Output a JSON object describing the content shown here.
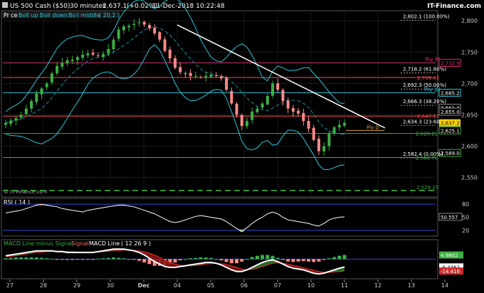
{
  "header": {
    "symbol": "US 500 Cash ($50)",
    "interval": "30 minutes",
    "last": "2,637.1",
    "change": "(+0.02%)",
    "datetime": "11-Dec-2018 10:22:48",
    "brand": "IT-Finance.com"
  },
  "indicator_legend": {
    "price": "Price",
    "boll_up": "Boll up",
    "boll_down": "Boll down",
    "boll_middle": "Boll middle",
    "boll_params": "( 20,2 )"
  },
  "watermark": "© IT-Finance.com",
  "colors": {
    "background": "#000000",
    "candle_up": "#3cb043",
    "candle_down": "#ff8a8a",
    "bollinger": "#2ec7d9",
    "bollinger_mid": "#1e8fa3",
    "trendline": "#ffffff",
    "pivot_line": "#d4306f",
    "fib_line": "#ff4d4d",
    "green_level": "#3cb043",
    "pivot_w": "#2ec7d9",
    "pivot_d": "#d9a441",
    "rsi_line": "#ffffff",
    "macd_line": "#ffffff",
    "signal_line": "#cc2b2b",
    "macd_hist_up": "#3cb043",
    "macd_hist_down": "#ff8a8a"
  },
  "chart_data": [
    {
      "type": "candlestick",
      "title": "US 500 Cash ($50) 30 minutes",
      "x_ticks": [
        "27",
        "28",
        "29",
        "30",
        "Dec",
        "04",
        "05",
        "06",
        "07",
        "10",
        "11",
        "12",
        "13",
        "14"
      ],
      "y_ticks": [
        "2,800",
        "2,750",
        "2,700",
        "2,650",
        "2,600",
        "2,550"
      ],
      "ylim": [
        2520,
        2815
      ],
      "close_series": [
        2637,
        2641,
        2645,
        2650,
        2660,
        2672,
        2684,
        2692,
        2700,
        2716,
        2728,
        2733,
        2737,
        2738,
        2742,
        2746,
        2748,
        2746,
        2744,
        2747,
        2755,
        2770,
        2786,
        2791,
        2792,
        2795,
        2798,
        2794,
        2788,
        2780,
        2770,
        2752,
        2740,
        2725,
        2718,
        2716,
        2712,
        2712,
        2710,
        2712,
        2714,
        2712,
        2708,
        2690,
        2668,
        2650,
        2632,
        2640,
        2655,
        2660,
        2668,
        2680,
        2700,
        2690,
        2672,
        2660,
        2655,
        2652,
        2640,
        2628,
        2610,
        2592,
        2600,
        2620,
        2630,
        2634,
        2637
      ],
      "levels": [
        {
          "label": "2,802.1 (100.00%)",
          "value": 2802.1,
          "kind": "fib"
        },
        {
          "label": "Piv M",
          "value": 2732.9,
          "kind": "pivot"
        },
        {
          "label": "2,732.9",
          "value": 2732.9,
          "kind": "pivot_box"
        },
        {
          "label": "2,718.2 (61.80%)",
          "value": 2718.2,
          "kind": "fib"
        },
        {
          "label": "2,709.45",
          "value": 2709.45,
          "kind": "red"
        },
        {
          "label": "2,692.3 (50.00%)",
          "value": 2692.3,
          "kind": "fib"
        },
        {
          "label": "Piv W",
          "value": 2685.2,
          "kind": "pivot_w"
        },
        {
          "label": "2,685.2",
          "value": 2685.2,
          "kind": "pivot_w_box"
        },
        {
          "label": "2,666.3 (38.20%)",
          "value": 2666.3,
          "kind": "fib"
        },
        {
          "label": "2,661.2",
          "value": 2661.2,
          "kind": "plain_box"
        },
        {
          "label": "2,647.95",
          "value": 2647.95,
          "kind": "red"
        },
        {
          "label": "2,655.0",
          "value": 2655.0,
          "kind": "plain_box"
        },
        {
          "label": "2,634.3 (23.60%)",
          "value": 2634.3,
          "kind": "fib"
        },
        {
          "label": "2,637.2",
          "value": 2637.2,
          "kind": "last_box"
        },
        {
          "label": "Piv D",
          "value": 2625.1,
          "kind": "pivot_d"
        },
        {
          "label": "2,625.1",
          "value": 2625.1,
          "kind": "green_box"
        },
        {
          "label": "2,620.22",
          "value": 2620.22,
          "kind": "green"
        },
        {
          "label": "2,589.0",
          "value": 2589.0,
          "kind": "green_box"
        },
        {
          "label": "2,582.4 (0.00%)",
          "value": 2582.4,
          "kind": "fib"
        },
        {
          "label": "2,581.78",
          "value": 2581.78,
          "kind": "green"
        },
        {
          "label": "2,529.27",
          "value": 2529.27,
          "kind": "green_dashed"
        }
      ]
    },
    {
      "type": "line",
      "title": "RSI ( 14 )",
      "y_ticks": [
        "80",
        "50",
        "20"
      ],
      "ylim": [
        10,
        90
      ],
      "values": [
        60,
        62,
        64,
        66,
        70,
        74,
        78,
        80,
        78,
        76,
        74,
        70,
        68,
        66,
        64,
        62,
        66,
        68,
        70,
        72,
        74,
        76,
        78,
        78,
        76,
        74,
        70,
        66,
        62,
        58,
        52,
        46,
        40,
        38,
        40,
        44,
        48,
        52,
        54,
        52,
        50,
        48,
        46,
        40,
        32,
        24,
        18,
        26,
        36,
        44,
        50,
        58,
        62,
        58,
        50,
        44,
        42,
        40,
        38,
        36,
        32,
        30,
        36,
        44,
        48,
        50,
        51
      ],
      "last_value": "50.557"
    },
    {
      "type": "line",
      "title": "MACD ( 12 26 9 )",
      "legend": [
        "MACD Line minus Signal",
        "Signal",
        "MACD Line"
      ],
      "ylim": [
        -22,
        14
      ],
      "macd": [
        4,
        5,
        6,
        7,
        8,
        9,
        10,
        10,
        10,
        10,
        9,
        9,
        8,
        8,
        8,
        8,
        8,
        8,
        9,
        10,
        11,
        12,
        12,
        12,
        11,
        10,
        8,
        5,
        1,
        -3,
        -6,
        -9,
        -10,
        -10,
        -9,
        -8,
        -7,
        -6,
        -5,
        -4,
        -4,
        -5,
        -7,
        -10,
        -13,
        -15,
        -15,
        -13,
        -10,
        -7,
        -4,
        -2,
        -1,
        -3,
        -6,
        -9,
        -11,
        -12,
        -13,
        -15,
        -17,
        -18,
        -17,
        -15,
        -13,
        -11,
        -9.4
      ],
      "signal": [
        3,
        3.5,
        4,
        5,
        6,
        7,
        8,
        8.5,
        9,
        9.5,
        9.5,
        9.5,
        9,
        9,
        8.5,
        8.5,
        8.5,
        8.5,
        8.5,
        9,
        9.5,
        10,
        10.5,
        11,
        11,
        10.5,
        10,
        9,
        7,
        5,
        2,
        -1,
        -4,
        -6,
        -7.5,
        -8,
        -8,
        -7.5,
        -7,
        -6,
        -5.5,
        -5,
        -5.5,
        -6.5,
        -8,
        -10,
        -12,
        -13,
        -12.5,
        -11,
        -9,
        -7,
        -5,
        -4.5,
        -5,
        -6,
        -7.5,
        -9,
        -10.5,
        -12,
        -13.5,
        -15,
        -16,
        -16,
        -15.5,
        -15,
        -14.4
      ],
      "hist": [
        1,
        1.5,
        2,
        2,
        2,
        2,
        2,
        1.5,
        1,
        0.5,
        -0.5,
        -0.5,
        -1,
        -1,
        -0.5,
        -0.5,
        -0.5,
        -0.5,
        0.5,
        1,
        1.5,
        2,
        1.5,
        1,
        0,
        -0.5,
        -2,
        -4,
        -6,
        -8,
        -8,
        -8,
        -6,
        -4,
        -1.5,
        0,
        1,
        1.5,
        2,
        2,
        1.5,
        0,
        -1.5,
        -3.5,
        -5,
        -5,
        -3,
        0,
        2.5,
        4,
        5,
        5,
        4,
        1.5,
        -1,
        -3,
        -3.5,
        -3,
        -2.5,
        -3,
        -3.5,
        -3,
        -1,
        1,
        2.5,
        4,
        5
      ],
      "value_labels": [
        "4.9802",
        "-9.4362",
        "-14.416"
      ]
    }
  ]
}
